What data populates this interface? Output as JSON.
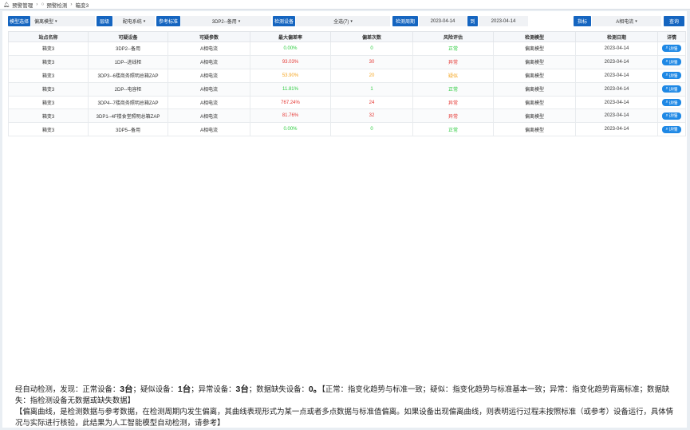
{
  "breadcrumb": {
    "items": [
      "预警管理",
      "预警检测",
      "箱变3"
    ]
  },
  "filters": {
    "model_tag": "模型选择",
    "model_value": "偏离模型",
    "level_tag": "层级",
    "level_value": "配电系统",
    "ref_tag": "参考标准",
    "ref_value": "3DP2--备用",
    "device_tag": "检测设备",
    "device_value": "全选(7)",
    "cycle_tag": "检测周期",
    "date_from": "2023-04-14",
    "to_tag": "到",
    "date_to": "2023-04-14",
    "metric_tag": "指标",
    "metric_value": "A相电流",
    "query_label": "查询"
  },
  "table": {
    "headers": [
      "站点名称",
      "可疑设备",
      "可疑参数",
      "最大偏差率",
      "偏差次数",
      "风险评估",
      "检测模型",
      "检测日期",
      "详情"
    ],
    "detail_label": "详情",
    "rows": [
      {
        "station": "箱变3",
        "device": "3DP2--备用",
        "param": "A相电流",
        "rate": "0.00%",
        "count": "0",
        "risk": "正常",
        "model": "偏离模型",
        "date": "2023-04-14",
        "color": "#2ecc40"
      },
      {
        "station": "箱变3",
        "device": "1DP--进线柜",
        "param": "A相电流",
        "rate": "93.03%",
        "count": "30",
        "risk": "异常",
        "model": "偏离模型",
        "date": "2023-04-14",
        "color": "#e53935"
      },
      {
        "station": "箱变3",
        "device": "3DP3--6楼商务照明总箱ZAP",
        "param": "A相电流",
        "rate": "53.90%",
        "count": "20",
        "risk": "疑似",
        "model": "偏离模型",
        "date": "2023-04-14",
        "color": "#f5a623"
      },
      {
        "station": "箱变3",
        "device": "2DP--电容柜",
        "param": "A相电流",
        "rate": "11.81%",
        "count": "1",
        "risk": "正常",
        "model": "偏离模型",
        "date": "2023-04-14",
        "color": "#2ecc40"
      },
      {
        "station": "箱变3",
        "device": "3DP4--7楼商务照明总箱ZAP",
        "param": "A相电流",
        "rate": "767.24%",
        "count": "24",
        "risk": "异常",
        "model": "偏离模型",
        "date": "2023-04-14",
        "color": "#e53935"
      },
      {
        "station": "箱变3",
        "device": "3DP1--4F楼食堂照明总箱ZAP",
        "param": "A相电流",
        "rate": "81.76%",
        "count": "32",
        "risk": "异常",
        "model": "偏离模型",
        "date": "2023-04-14",
        "color": "#e53935"
      },
      {
        "station": "箱变3",
        "device": "3DP5--备用",
        "param": "A相电流",
        "rate": "0.00%",
        "count": "0",
        "risk": "正常",
        "model": "偏离模型",
        "date": "2023-04-14",
        "color": "#2ecc40"
      }
    ]
  },
  "summary": {
    "p1_a": "经自动检测，发现：正常设备：",
    "n_normal": "3台",
    "p1_b": "；疑似设备：",
    "n_suspect": "1台",
    "p1_c": "；异常设备：",
    "n_abnormal": "3台",
    "p1_d": "；数据缺失设备：",
    "n_missing": "0。",
    "p1_e": "【正常：指变化趋势与标准一致；疑似：指变化趋势与标准基本一致；异常：指变化趋势背离标准；数据缺失：指检测设备无数据或缺失数据】",
    "p2": "【偏离曲线，是检测数据与参考数据，在检测周期内发生偏离，其曲线表现形式为某一点或者多点数据与标准值偏离。如果设备出现偏离曲线，则表明运行过程未按照标准（或参考）设备运行，具体情况与实际进行核验，此结果为人工智能模型自动检测，请参考】"
  }
}
